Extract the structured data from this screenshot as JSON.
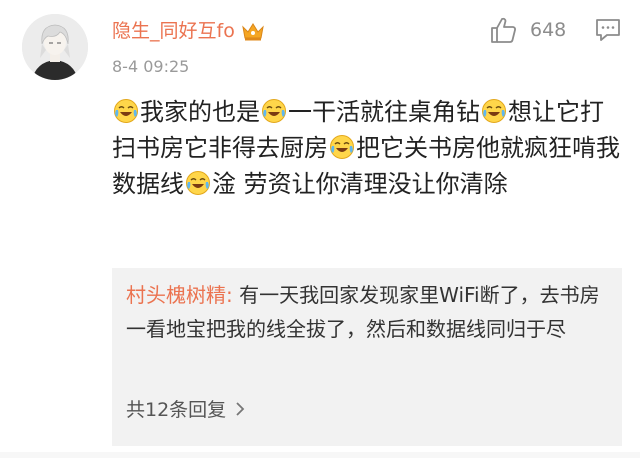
{
  "comment": {
    "username": "隐生_同好互fo",
    "timestamp": "8-4 09:25",
    "like_count": "648",
    "body": {
      "s1": "我家的也是",
      "s2": "一干活就往桌角钻",
      "s3": "想让它打扫书房它非得去厨房",
      "s4": "把它关书房他就疯狂啃我数据线",
      "s5": "淦 劳资让你清理没让你清除"
    }
  },
  "reply": {
    "author": "村头槐树精:",
    "text": " 有一天我回家发现家里WiFi断了，去书房一看地宝把我的线全拔了，然后和数据线同归于尽",
    "more_label": "共12条回复"
  },
  "icons": {
    "crown": "crown-icon",
    "like": "thumb-up-icon",
    "comment": "comment-icon",
    "emoji": "laugh-cry-emoji-icon",
    "chevron": "chevron-right-icon"
  },
  "colors": {
    "username": "#eb7350",
    "reply_author": "#eb7350",
    "reply_bg": "#f2f2f2",
    "crown": "#f5a623"
  }
}
